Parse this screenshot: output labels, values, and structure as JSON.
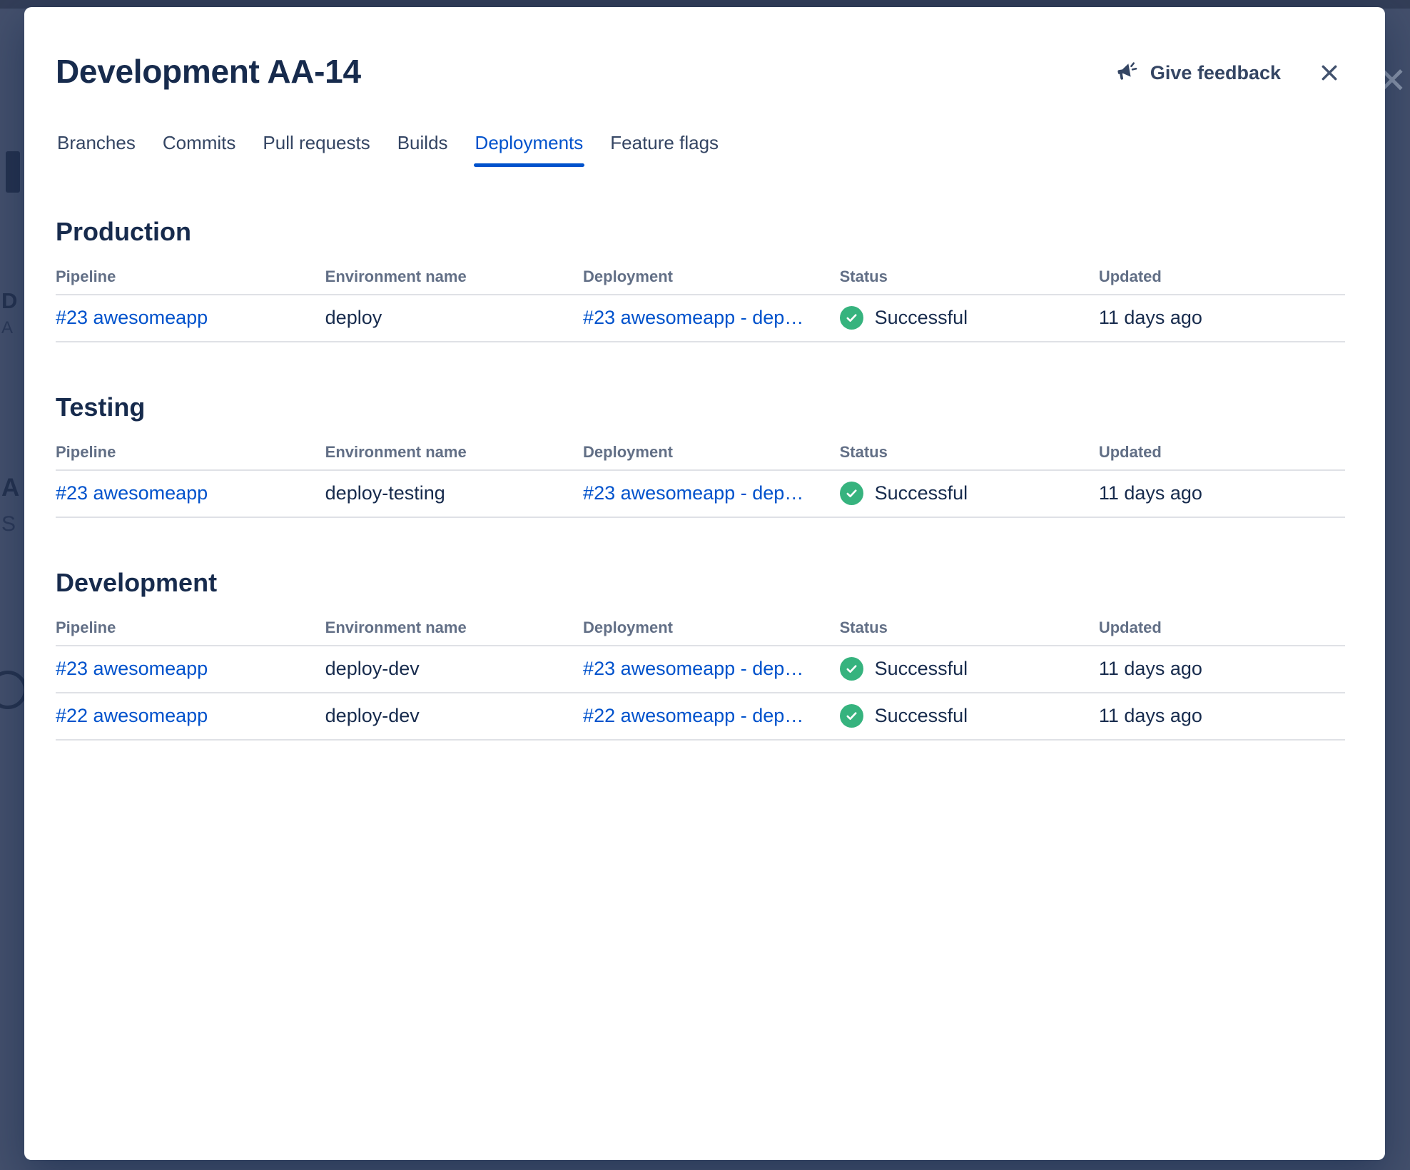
{
  "theme": {
    "accent": "#0052CC",
    "success": "#36B37E",
    "text": "#172B4D",
    "muted": "#626F86",
    "border": "#DFE1E6",
    "backdrop": "#44506C",
    "tab": "#344563"
  },
  "modal": {
    "title": "Development AA-14",
    "feedback_label": "Give feedback",
    "tabs": [
      {
        "label": "Branches"
      },
      {
        "label": "Commits"
      },
      {
        "label": "Pull requests"
      },
      {
        "label": "Builds"
      },
      {
        "label": "Deployments"
      },
      {
        "label": "Feature flags"
      }
    ],
    "columns": [
      "Pipeline",
      "Environment name",
      "Deployment",
      "Status",
      "Updated"
    ],
    "sections": [
      {
        "title": "Production",
        "rows": [
          {
            "pipeline": "#23 awesomeapp",
            "environment": "deploy",
            "deployment": "#23 awesomeapp - dep…",
            "status": "Successful",
            "updated": "11 days ago"
          }
        ]
      },
      {
        "title": "Testing",
        "rows": [
          {
            "pipeline": "#23 awesomeapp",
            "environment": "deploy-testing",
            "deployment": "#23 awesomeapp - dep…",
            "status": "Successful",
            "updated": "11 days ago"
          }
        ]
      },
      {
        "title": "Development",
        "rows": [
          {
            "pipeline": "#23 awesomeapp",
            "environment": "deploy-dev",
            "deployment": "#23 awesomeapp - dep…",
            "status": "Successful",
            "updated": "11 days ago"
          },
          {
            "pipeline": "#22 awesomeapp",
            "environment": "deploy-dev",
            "deployment": "#22 awesomeapp - dep…",
            "status": "Successful",
            "updated": "11 days ago"
          }
        ]
      }
    ]
  },
  "background": {
    "fragments": {
      "letter_d": "D",
      "letter_a1": "A",
      "letter_a2": "A",
      "letter_s": "S",
      "close": "✕"
    }
  }
}
